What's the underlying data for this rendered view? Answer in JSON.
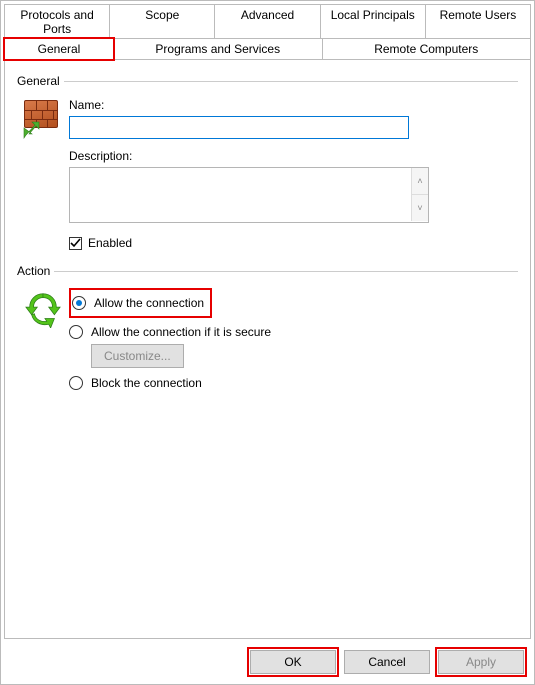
{
  "tabs_top": [
    "Protocols and Ports",
    "Scope",
    "Advanced",
    "Local Principals",
    "Remote Users"
  ],
  "tabs_bottom": [
    "General",
    "Programs and Services",
    "Remote Computers"
  ],
  "active_tab": "General",
  "general": {
    "legend": "General",
    "name_label": "Name:",
    "name_value": "",
    "description_label": "Description:",
    "description_value": "",
    "enabled_label": "Enabled",
    "enabled_checked": true
  },
  "action": {
    "legend": "Action",
    "options": {
      "allow": "Allow the connection",
      "allow_secure": "Allow the connection if it is secure",
      "block": "Block the connection"
    },
    "selected": "allow",
    "customize_label": "Customize...",
    "customize_enabled": false
  },
  "buttons": {
    "ok": "OK",
    "cancel": "Cancel",
    "apply": "Apply"
  },
  "apply_enabled": false,
  "highlights": {
    "general_tab": true,
    "allow_option": true,
    "ok": true,
    "apply": true
  }
}
